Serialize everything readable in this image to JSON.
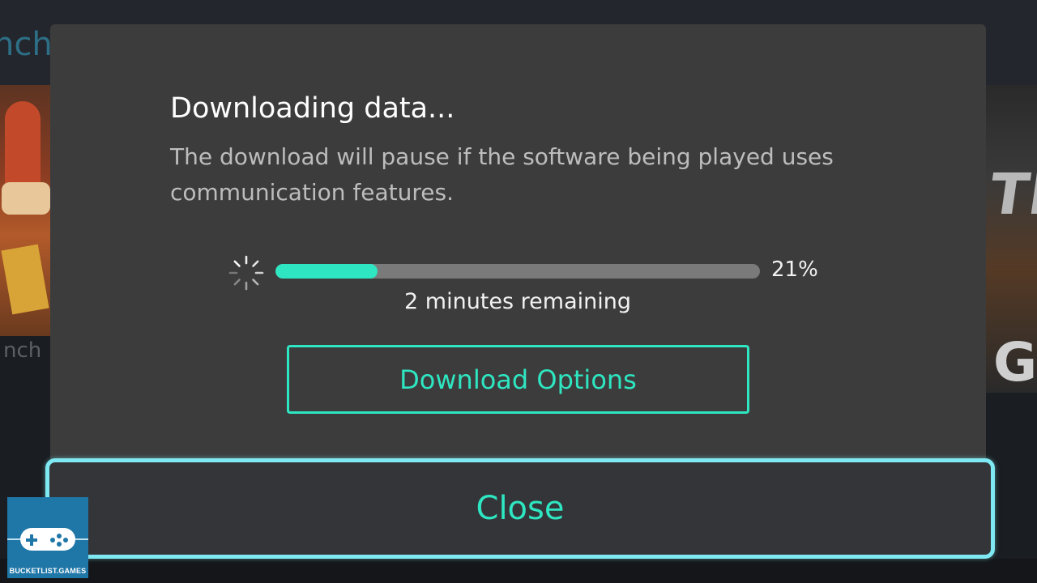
{
  "background": {
    "partial_title": "nch",
    "left_caption": "nch",
    "right_tile_text": [
      "TE",
      "G"
    ]
  },
  "dialog": {
    "title": "Downloading data...",
    "description": "The download will pause if the software being played uses communication features.",
    "progress": {
      "percent_label": "21%",
      "fraction": 0.21,
      "remaining": "2 minutes remaining"
    },
    "download_options_label": "Download Options",
    "spinner_icon": "loading-spinner-icon"
  },
  "footer": {
    "close_label": "Close"
  },
  "watermark": {
    "text": "BUCKETLIST.GAMES",
    "icon": "gamepad-icon"
  },
  "colors": {
    "accent": "#2ee6c1",
    "focus_border": "#7ee9f2",
    "dialog_bg": "#3c3c3c",
    "progress_track": "#7a7a7a"
  }
}
